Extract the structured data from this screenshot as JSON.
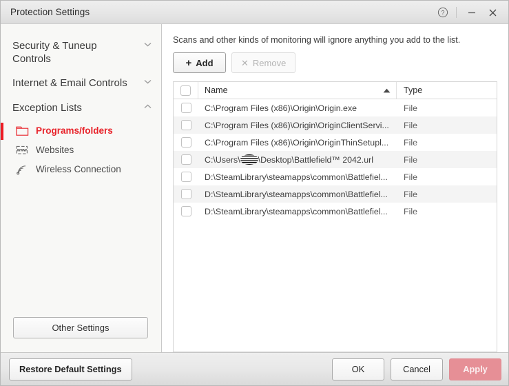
{
  "window": {
    "title": "Protection Settings",
    "controls": [
      {
        "name": "help-icon",
        "glyph": "?"
      },
      {
        "name": "minimize-button",
        "glyph": "–"
      },
      {
        "name": "close-button",
        "glyph": "✕"
      }
    ]
  },
  "sidebar": {
    "sections": [
      {
        "label": "Security & Tuneup Controls",
        "expanded": false,
        "chevron": "chevron-down-icon"
      },
      {
        "label": "Internet & Email Controls",
        "expanded": false,
        "chevron": "chevron-down-icon"
      },
      {
        "label": "Exception Lists",
        "expanded": true,
        "chevron": "chevron-up-icon"
      }
    ],
    "items": [
      {
        "label": "Programs/folders",
        "icon": "folder-icon",
        "selected": true
      },
      {
        "label": "Websites",
        "icon": "www-icon",
        "selected": false
      },
      {
        "label": "Wireless Connection",
        "icon": "wireless-signal-icon",
        "selected": false
      }
    ],
    "other_settings_label": "Other Settings"
  },
  "main": {
    "description": "Scans and other kinds of monitoring will ignore anything you add to the list.",
    "toolbar": {
      "add_label": "Add",
      "add_enabled": true,
      "remove_label": "Remove",
      "remove_enabled": false
    },
    "table": {
      "columns": [
        {
          "key": "name",
          "label": "Name",
          "sorted": "ascending"
        },
        {
          "key": "type",
          "label": "Type",
          "sorted": "none"
        }
      ],
      "header_checkbox_checked": false,
      "rows": [
        {
          "checked": false,
          "name": "C:\\Program Files (x86)\\Origin\\Origin.exe",
          "type": "File",
          "redacted": false
        },
        {
          "checked": false,
          "name": "C:\\Program Files (x86)\\Origin\\OriginClientServi...",
          "type": "File",
          "redacted": false
        },
        {
          "checked": false,
          "name": "C:\\Program Files (x86)\\Origin\\OriginThinSetupl...",
          "type": "File",
          "redacted": false
        },
        {
          "checked": false,
          "name_before": "C:\\Users\\",
          "name_after": "\\Desktop\\Battlefield™ 2042.url",
          "type": "File",
          "redacted": true
        },
        {
          "checked": false,
          "name": "D:\\SteamLibrary\\steamapps\\common\\Battlefiel...",
          "type": "File",
          "redacted": false
        },
        {
          "checked": false,
          "name": "D:\\SteamLibrary\\steamapps\\common\\Battlefiel...",
          "type": "File",
          "redacted": false
        },
        {
          "checked": false,
          "name": "D:\\SteamLibrary\\steamapps\\common\\Battlefiel...",
          "type": "File",
          "redacted": false
        }
      ]
    }
  },
  "footer": {
    "restore_label": "Restore Default Settings",
    "ok_label": "OK",
    "cancel_label": "Cancel",
    "apply_label": "Apply"
  },
  "colors": {
    "accent_red": "#ec1c24",
    "apply_pink": "#e68f96",
    "sidebar_bg": "#f8f8f6",
    "row_stripe": "#f4f4f4",
    "chrome_grey": "#e8e8e8"
  }
}
